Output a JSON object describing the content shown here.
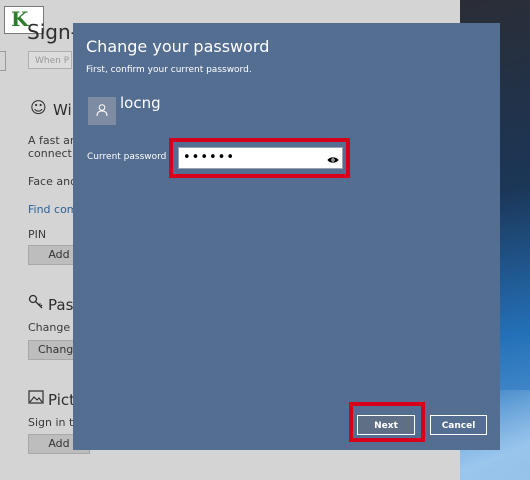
{
  "background": {
    "logo_text": "K",
    "page_title": "Sign-i",
    "search_placeholder": "When P",
    "hello_heading": "Wi",
    "hello_desc_line1": "A fast and",
    "hello_desc_line2": "connect to",
    "face_label": "Face and f",
    "find_link": "Find comp",
    "pin_label": "PIN",
    "pin_add": "Add",
    "password_heading": "Pass",
    "password_desc": "Change yo",
    "password_change": "Change",
    "picture_heading": "Pictu",
    "picture_desc": "Sign in to",
    "picture_add": "Add"
  },
  "dialog": {
    "title": "Change your password",
    "subtitle": "First, confirm your current password.",
    "username": "locng",
    "field_label": "Current password",
    "password_value": "••••••",
    "next_label": "Next",
    "cancel_label": "Cancel"
  },
  "colors": {
    "dialog_bg": "#546e92",
    "highlight": "#d6001c"
  },
  "icons": {
    "avatar": "user-icon",
    "reveal": "eye-icon",
    "hello": "smiley-icon",
    "password": "key-icon",
    "picture": "picture-icon"
  }
}
